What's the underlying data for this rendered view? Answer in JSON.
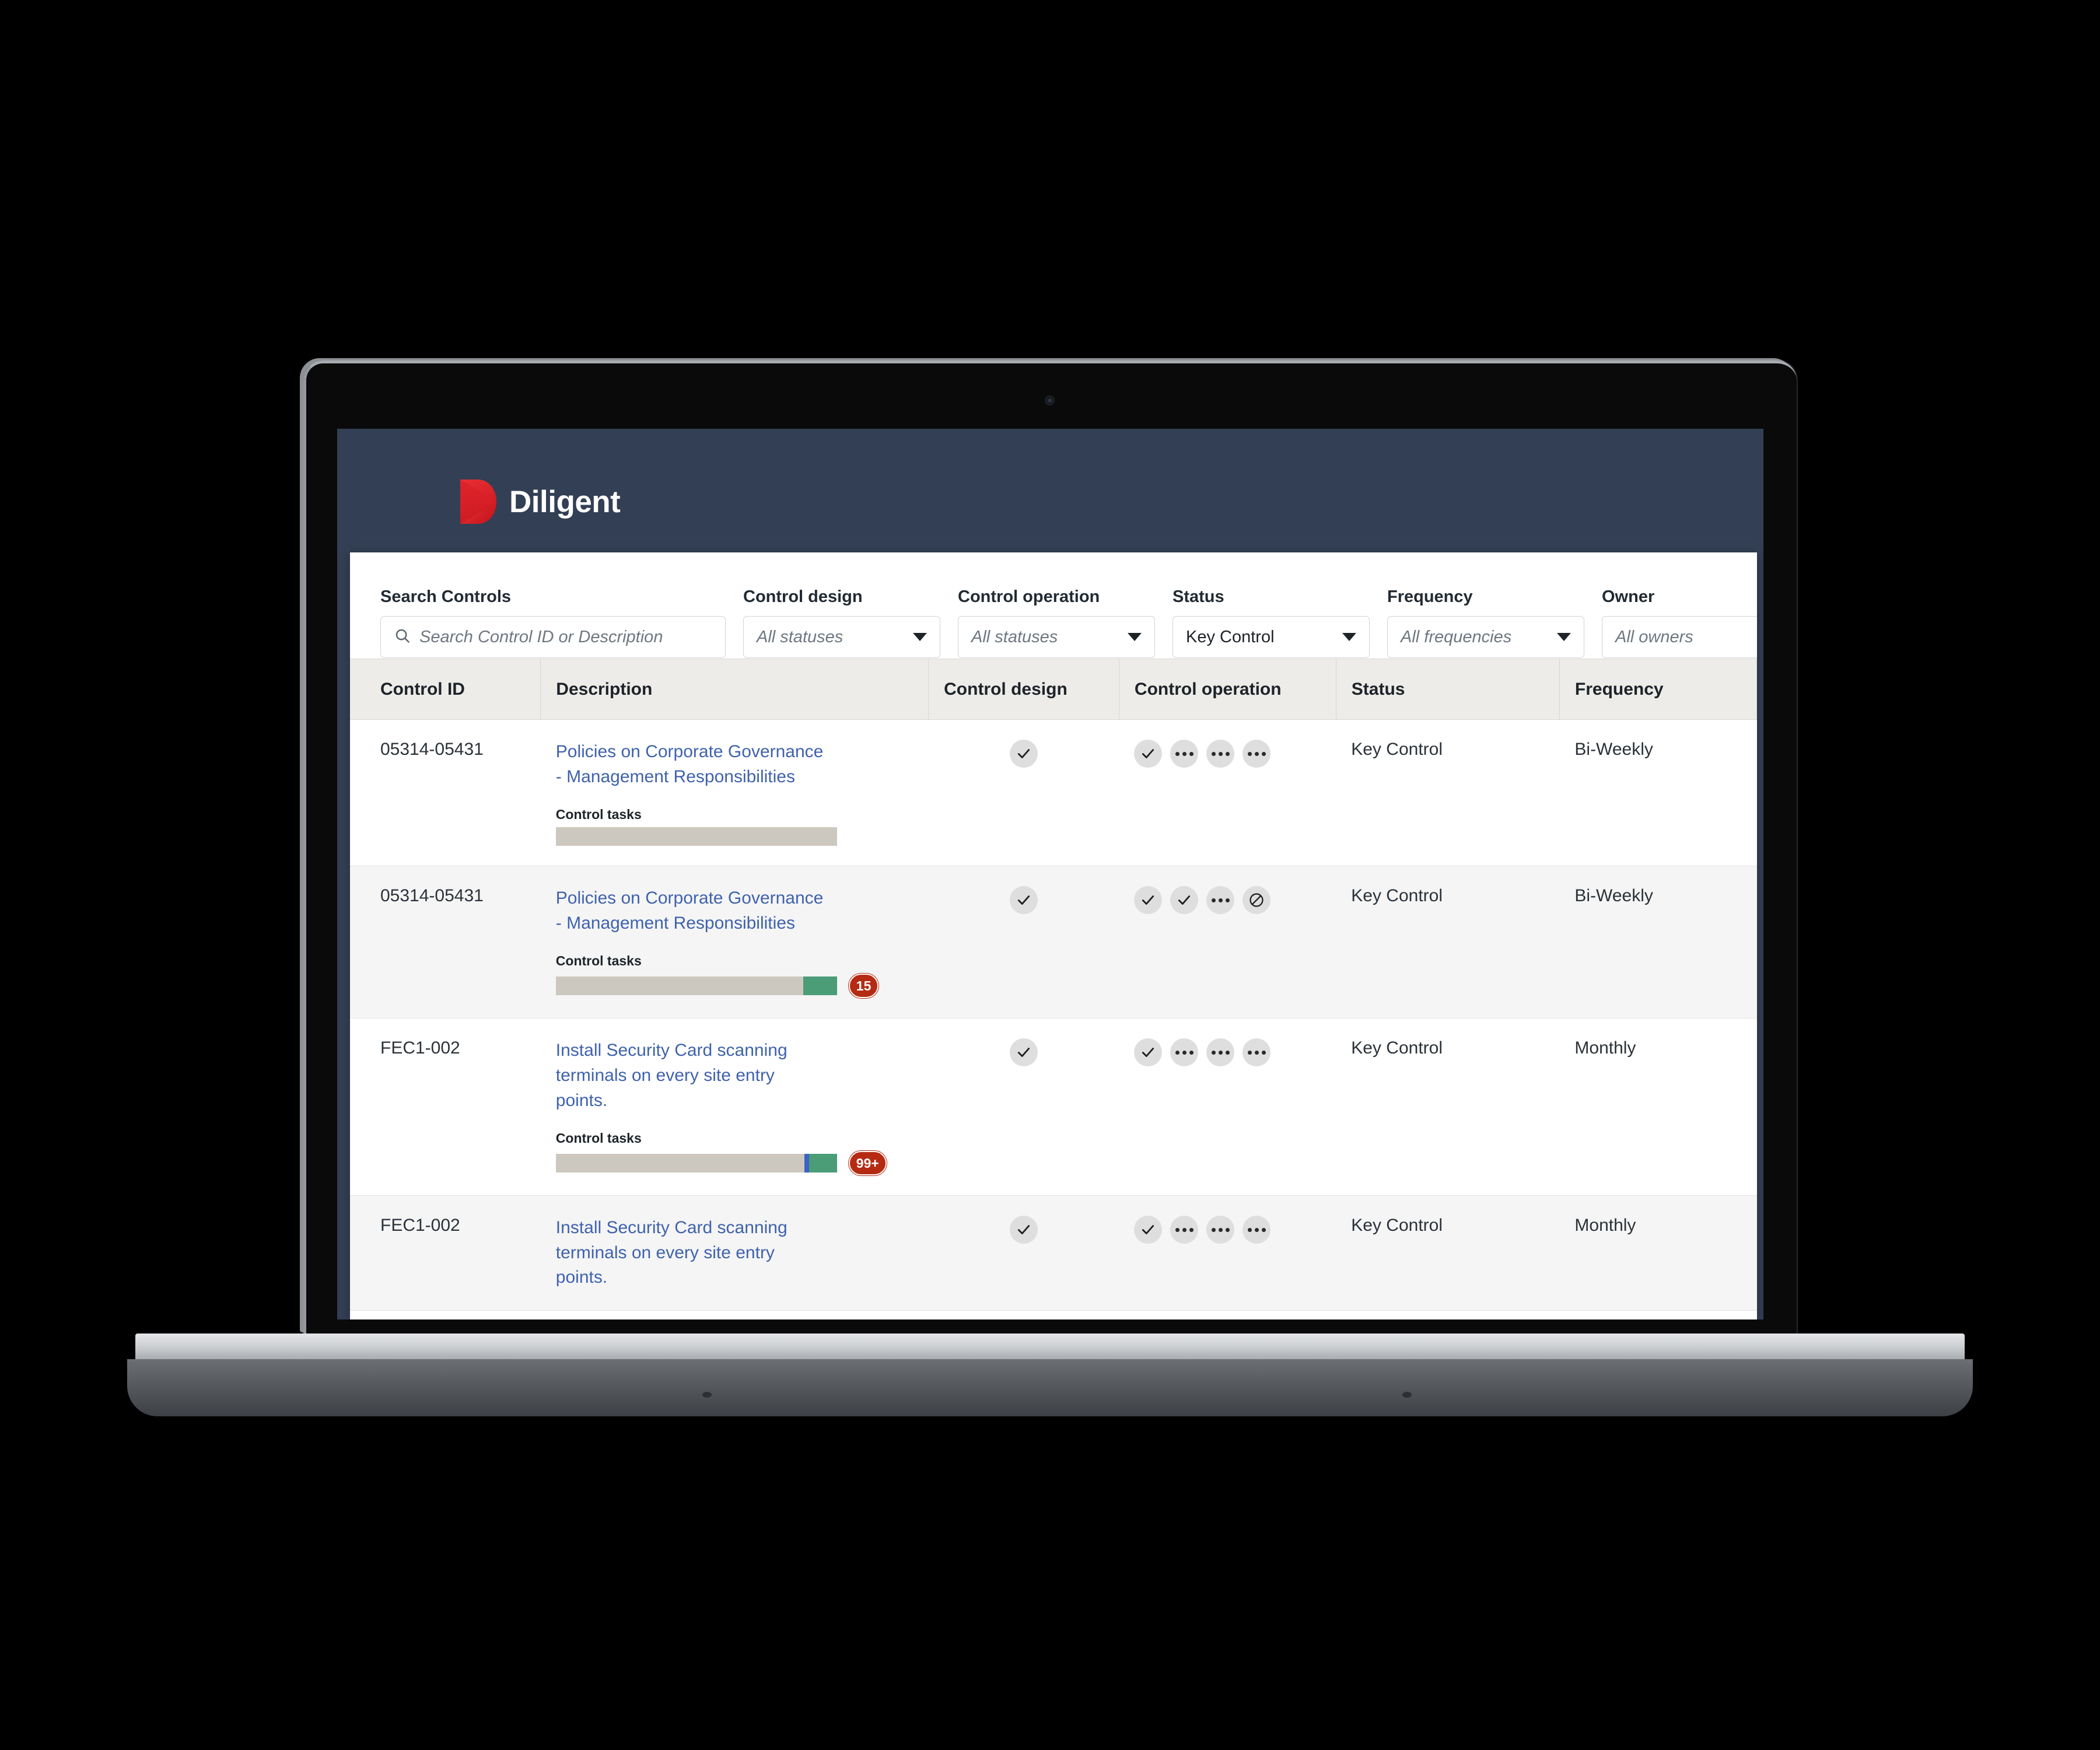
{
  "brand": {
    "name": "Diligent",
    "logo_icon": "diligent-shield-icon",
    "header_bg": "#333f54",
    "logo_color": "#e8242a"
  },
  "filters": {
    "search": {
      "label": "Search Controls",
      "placeholder": "Search Control ID or Description",
      "value": "",
      "icon": "search-icon"
    },
    "selects": [
      {
        "label": "Control design",
        "value": "All statuses",
        "selected": false,
        "name": "control-design"
      },
      {
        "label": "Control operation",
        "value": "All statuses",
        "selected": false,
        "name": "control-operation"
      },
      {
        "label": "Status",
        "value": "Key Control",
        "selected": true,
        "name": "status"
      },
      {
        "label": "Frequency",
        "value": "All frequencies",
        "selected": false,
        "name": "frequency"
      },
      {
        "label": "Owner",
        "value": "All owners",
        "selected": false,
        "name": "owner"
      }
    ]
  },
  "table": {
    "columns": [
      "Control ID",
      "Description",
      "Control design",
      "Control operation",
      "Status",
      "Frequency"
    ],
    "tasks_label": "Control tasks",
    "rows": [
      {
        "control_id": "05314-05431",
        "description": "Policies on Corporate Governance - Management Responsibilities",
        "has_tasks": true,
        "progress": {
          "green_pct": 0,
          "blue_pct": 0
        },
        "badge": "",
        "control_design": [
          "check"
        ],
        "control_operation": [
          "check",
          "dots",
          "dots",
          "dots"
        ],
        "status": "Key Control",
        "frequency": "Bi-Weekly"
      },
      {
        "control_id": "05314-05431",
        "description": "Policies on Corporate Governance - Management Responsibilities",
        "has_tasks": true,
        "progress": {
          "green_pct": 12,
          "blue_pct": 0
        },
        "badge": "15",
        "control_design": [
          "check"
        ],
        "control_operation": [
          "check",
          "check",
          "dots",
          "blocked"
        ],
        "status": "Key Control",
        "frequency": "Bi-Weekly"
      },
      {
        "control_id": "FEC1-002",
        "description": "Install Security Card scanning terminals on every site entry points.",
        "has_tasks": true,
        "progress": {
          "green_pct": 10,
          "blue_pct": 1.5
        },
        "badge": "99+",
        "control_design": [
          "check"
        ],
        "control_operation": [
          "check",
          "dots",
          "dots",
          "dots"
        ],
        "status": "Key Control",
        "frequency": "Monthly"
      },
      {
        "control_id": "FEC1-002",
        "description": "Install Security Card scanning terminals on every site entry points.",
        "has_tasks": false,
        "progress": {
          "green_pct": 0,
          "blue_pct": 0
        },
        "badge": "",
        "control_design": [
          "check"
        ],
        "control_operation": [
          "check",
          "dots",
          "dots",
          "dots"
        ],
        "status": "Key Control",
        "frequency": "Monthly"
      }
    ]
  },
  "colors": {
    "link": "#3f62ad",
    "badge_red": "#b52a12",
    "progress_track": "#cdc8bf",
    "progress_green": "#4a9d77",
    "progress_blue": "#3b62c4",
    "header_row": "#edece8"
  }
}
